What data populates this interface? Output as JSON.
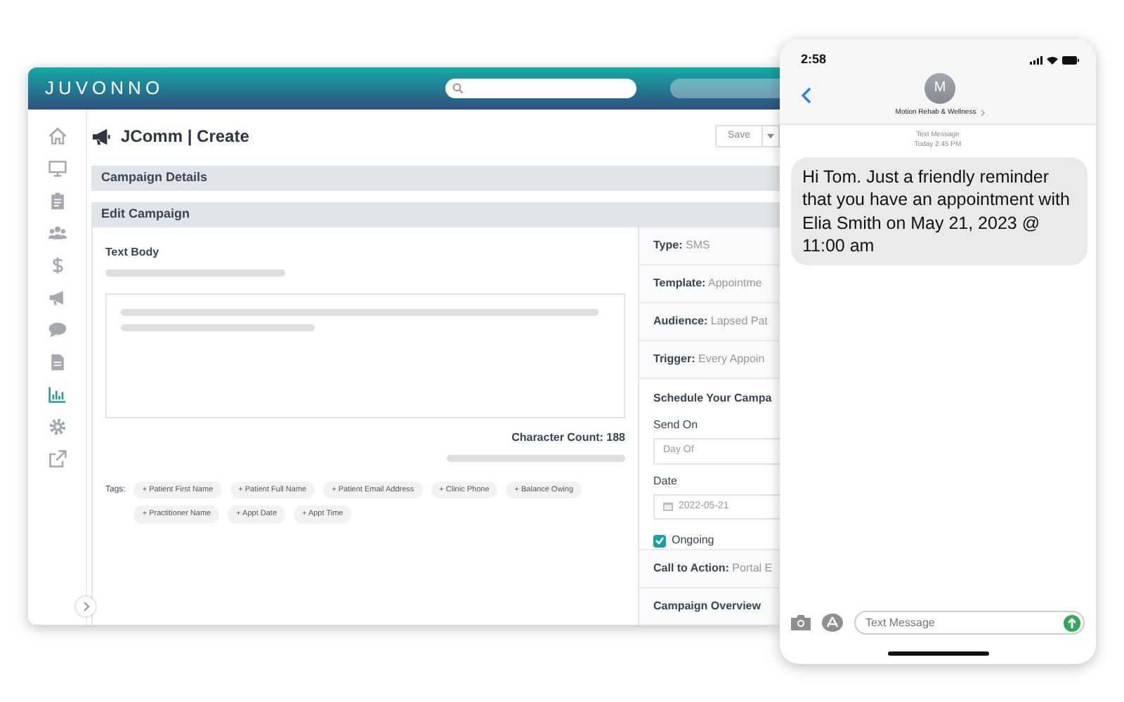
{
  "app": {
    "logo": "JUVONNO",
    "sidebar": {
      "items": [
        {
          "kind": "home",
          "selected": false
        },
        {
          "kind": "monitor",
          "selected": false
        },
        {
          "kind": "clipboard",
          "selected": false
        },
        {
          "kind": "users",
          "selected": false
        },
        {
          "kind": "dollar",
          "selected": false
        },
        {
          "kind": "megaphone",
          "selected": false
        },
        {
          "kind": "chat",
          "selected": false
        },
        {
          "kind": "document",
          "selected": false
        },
        {
          "kind": "chart",
          "selected": true
        },
        {
          "kind": "gear",
          "selected": false
        },
        {
          "kind": "external",
          "selected": false
        }
      ]
    },
    "page_title": "JComm | Create",
    "save_button": "Save",
    "sections": [
      "Campaign Details",
      "Edit Campaign"
    ],
    "text_body": {
      "label": "Text Body",
      "character_count": "Character Count: 188"
    },
    "tags": {
      "label": "Tags:",
      "items": [
        "+ Patient First Name",
        "+ Patient Full Name",
        "+ Patient Email Address",
        "+ Clinic Phone",
        "+ Balance Owing",
        "+ Practitioner Name",
        "+ Appt Date",
        "+ Appt Time"
      ]
    },
    "details": [
      {
        "label": "Type:",
        "value": "SMS"
      },
      {
        "label": "Template:",
        "value": "Appointme"
      },
      {
        "label": "Audience:",
        "value": "Lapsed Pat"
      },
      {
        "label": "Trigger:",
        "value": "Every Appoin"
      }
    ],
    "schedule": {
      "title": "Schedule Your Campa",
      "send_on": {
        "label": "Send On",
        "value": "Day Of"
      },
      "date": {
        "label": "Date",
        "value": "2022-05-21"
      },
      "ongoing": {
        "label": "Ongoing",
        "checked": true
      }
    },
    "call_to_action": {
      "label": "Call to Action:",
      "value": "Portal E"
    },
    "overview": "Campaign Overview"
  },
  "phone": {
    "time": "2:58",
    "avatar": "M",
    "contact": "Motion Rehab & Wellness",
    "meta": [
      "Text Message",
      "Today 2:45 PM"
    ],
    "message": "Hi Tom. Just a friendly reminder that you have an appointment with Elia Smith on May 21, 2023 @ 11:00 am",
    "input": {
      "placeholder": "Text Message"
    }
  }
}
